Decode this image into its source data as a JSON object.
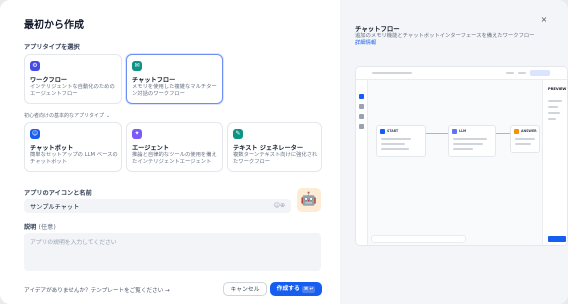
{
  "dialog": {
    "title": "最初から作成",
    "close_label": "×"
  },
  "app_type": {
    "label": "アプリタイプを選択",
    "primary": [
      {
        "title": "ワークフロー",
        "desc": "インテリジェントな自動化のためのエージェントフロー",
        "icon": "workflow-icon",
        "color": "#444ce7"
      },
      {
        "title": "チャットフロー",
        "desc": "メモリを使用した複雑なマルチターン対話のワークフロー",
        "icon": "chatflow-icon",
        "color": "#0e9384"
      }
    ],
    "advanced_label": "初心者向けの基本的なアプリタイプ",
    "secondary": [
      {
        "title": "チャットボット",
        "desc": "簡単なセットアップの LLM ベースのチャットボット",
        "icon": "chatbot-icon",
        "color": "#155eef"
      },
      {
        "title": "エージェント",
        "desc": "推論と自律的なツールの使用を備えたインテリジェントエージェント",
        "icon": "agent-icon",
        "color": "#7a5af8"
      },
      {
        "title": "テキスト ジェネレーター",
        "desc": "複数ターンテキスト向けに強化されたワークフロー",
        "icon": "text-generator-icon",
        "color": "#0e9384"
      }
    ]
  },
  "app_identity": {
    "label": "アプリのアイコンと名前",
    "name_value": "サンプルチャット",
    "avatar_emoji": "🤖"
  },
  "description": {
    "label": "説明",
    "optional": "(任意)",
    "placeholder": "アプリの説明を入力してください"
  },
  "footer": {
    "template_link": "アイデアがありませんか？テンプレートをご覧ください →",
    "cancel": "キャンセル",
    "create": "作成する",
    "create_kbd": "⌘ ↵"
  },
  "preview": {
    "title": "チャットフロー",
    "desc": "追加のメモリ機能とチャットボットインターフェースを備えたワークフロー",
    "learn_more": "詳細情報",
    "nodes": [
      "START",
      "LLM",
      "ANSWER"
    ],
    "panel_title": "PREVIEW"
  },
  "colors": {
    "accent": "#155eef",
    "selected_border": "#6d8ff5"
  }
}
